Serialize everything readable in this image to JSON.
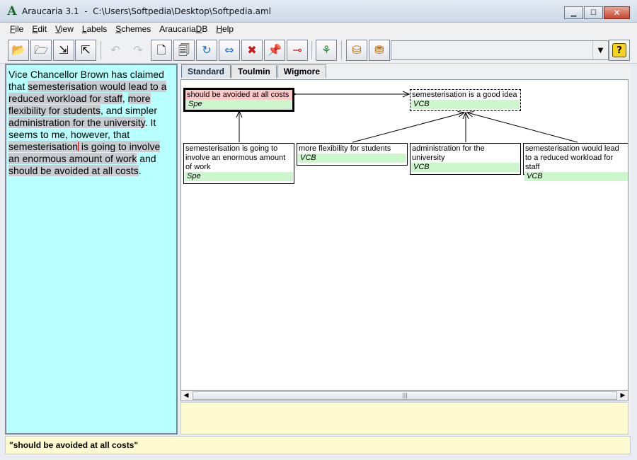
{
  "window": {
    "app_title": "Araucaria 3.1",
    "file_path": "C:\\Users\\Softpedia\\Desktop\\Softpedia.aml",
    "controls": {
      "minimize": "▁",
      "maximize": "☐",
      "close": "✕"
    }
  },
  "menu": [
    {
      "label": "File",
      "mnemonic": "F",
      "rest": "ile"
    },
    {
      "label": "Edit",
      "mnemonic": "E",
      "rest": "dit"
    },
    {
      "label": "View",
      "mnemonic": "V",
      "rest": "iew"
    },
    {
      "label": "Labels",
      "mnemonic": "L",
      "rest": "abels"
    },
    {
      "label": "Schemes",
      "mnemonic": "S",
      "rest": "chemes"
    },
    {
      "label": "AraucariaDB",
      "mnemonic_before": "Araucaria",
      "mnemonic": "D",
      "rest": "B"
    },
    {
      "label": "Help",
      "mnemonic": "H",
      "rest": "elp"
    }
  ],
  "toolbar": {
    "icons": [
      {
        "name": "open-file-icon",
        "glyph": "📂"
      },
      {
        "name": "open-folder-icon",
        "glyph": "🗁"
      },
      {
        "name": "import-icon",
        "glyph": "⇲"
      },
      {
        "name": "export-icon",
        "glyph": "⇱"
      },
      {
        "name": "undo-icon",
        "glyph": "↶"
      },
      {
        "name": "redo-icon",
        "glyph": "↷"
      },
      {
        "name": "new-document-icon",
        "glyph": "🗋"
      },
      {
        "name": "document-properties-icon",
        "glyph": "🗐"
      },
      {
        "name": "link-icon",
        "glyph": "↻"
      },
      {
        "name": "swap-icon",
        "glyph": "⇔"
      },
      {
        "name": "delete-icon",
        "glyph": "✖"
      },
      {
        "name": "pin-icon",
        "glyph": "📌"
      },
      {
        "name": "unpin-icon",
        "glyph": "⊸"
      },
      {
        "name": "tree-layout-icon",
        "glyph": "⚘"
      },
      {
        "name": "database-upload-icon",
        "glyph": "⛁"
      },
      {
        "name": "database-icon",
        "glyph": "⛃"
      }
    ],
    "combo_value": "",
    "help_glyph": "?"
  },
  "text_pane": {
    "segments": [
      {
        "t": "Vice Chancellor Brown has claimed that ",
        "hl": false
      },
      {
        "t": "semesterisation would lead to a reduced workload for staff",
        "hl": true
      },
      {
        "t": ", ",
        "hl": false
      },
      {
        "t": "more flexibility for students",
        "hl": true
      },
      {
        "t": ", and simpler ",
        "hl": false
      },
      {
        "t": "administration for the university",
        "hl": true
      },
      {
        "t": ". It seems to me, however, that ",
        "hl": false
      },
      {
        "t": "semesterisation",
        "hl": true,
        "caret_after": true
      },
      {
        "t": " is going to involve an enormous amount of work",
        "hl": true
      },
      {
        "t": " and ",
        "hl": false
      },
      {
        "t": "should be avoided at all costs",
        "hl": true
      },
      {
        "t": ".",
        "hl": false
      }
    ]
  },
  "tabs": [
    {
      "label": "Standard",
      "active": true
    },
    {
      "label": "Toulmin",
      "active": false
    },
    {
      "label": "Wigmore",
      "active": false
    }
  ],
  "diagram": {
    "nodes": [
      {
        "id": "n1",
        "text": "should be avoided at all costs",
        "label": "Spe",
        "selected": true
      },
      {
        "id": "n2",
        "text": "semesterisation is a good idea",
        "label": "VCB",
        "dashed": true
      },
      {
        "id": "n3",
        "text": "semesterisation is going to involve an enormous amount of work",
        "label": "Spe"
      },
      {
        "id": "n4",
        "text": "more flexibility for students",
        "label": "VCB"
      },
      {
        "id": "n5",
        "text": "administration for the university",
        "label": "VCB"
      },
      {
        "id": "n6",
        "text": "semesterisation would lead to a reduced workload for staff",
        "label": "VCB"
      }
    ]
  },
  "status_text": "\"should be avoided at all costs\""
}
